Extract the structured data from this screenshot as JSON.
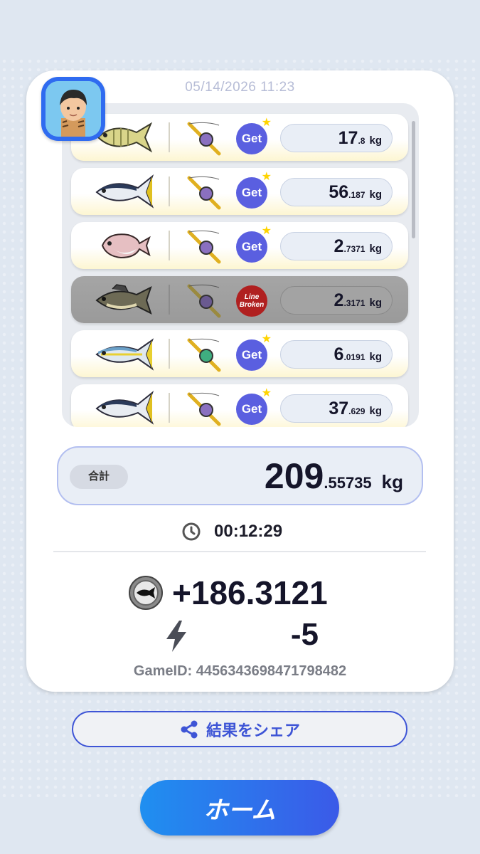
{
  "header": {
    "timestamp": "05/14/2026 11:23"
  },
  "catches": [
    {
      "species_icon": "fish-yellow-striped-icon",
      "status": "Get",
      "weight_int": "17",
      "weight_dec": ".8",
      "unit": "kg",
      "broken": false
    },
    {
      "species_icon": "fish-tuna-icon",
      "status": "Get",
      "weight_int": "56",
      "weight_dec": ".187",
      "unit": "kg",
      "broken": false
    },
    {
      "species_icon": "fish-pink-bream-icon",
      "status": "Get",
      "weight_int": "2",
      "weight_dec": ".7371",
      "unit": "kg",
      "broken": false
    },
    {
      "species_icon": "fish-bass-icon",
      "status": "Line Broken",
      "weight_int": "2",
      "weight_dec": ".3171",
      "unit": "kg",
      "broken": true
    },
    {
      "species_icon": "fish-yellowtail-icon",
      "status": "Get",
      "weight_int": "6",
      "weight_dec": ".0191",
      "unit": "kg",
      "broken": false
    },
    {
      "species_icon": "fish-tuna-icon",
      "status": "Get",
      "weight_int": "37",
      "weight_dec": ".629",
      "unit": "kg",
      "broken": false
    }
  ],
  "total": {
    "label": "合計",
    "weight_int": "209",
    "weight_dec": ".55735",
    "unit": "kg"
  },
  "elapsed_time": "00:12:29",
  "rewards": {
    "coin_delta": "+186.3121",
    "energy_delta": "-5"
  },
  "game_id": "GameID: 4456343698471798482",
  "buttons": {
    "share_label": "結果をシェア",
    "home_label": "ホーム"
  },
  "colors": {
    "accent": "#3e55d6",
    "get_badge": "#5a5fe0",
    "broken_badge": "#b02020"
  }
}
